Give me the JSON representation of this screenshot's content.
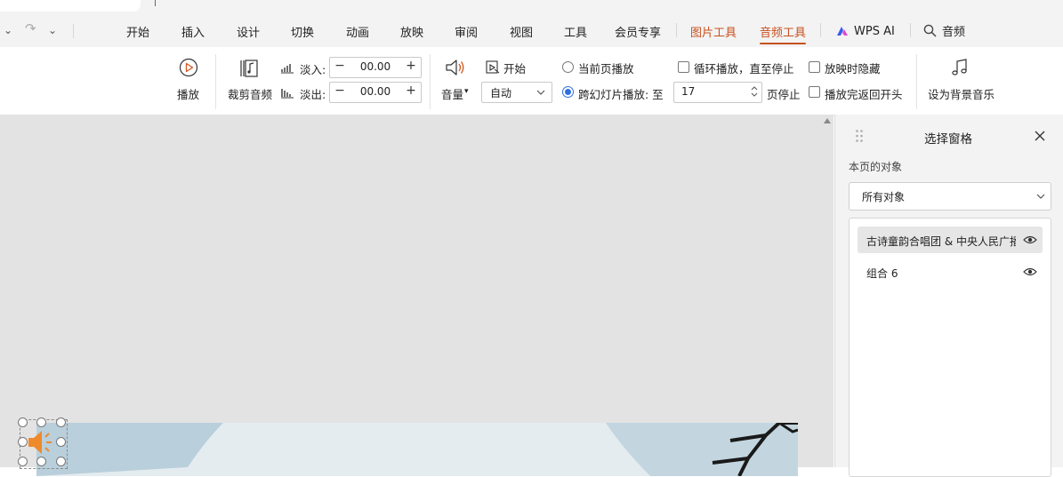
{
  "toolbar_top": {
    "redo_glyph": "↷",
    "more_glyph": "⌄"
  },
  "menu": {
    "tabs": [
      {
        "label": "开始"
      },
      {
        "label": "插入"
      },
      {
        "label": "设计"
      },
      {
        "label": "切换"
      },
      {
        "label": "动画"
      },
      {
        "label": "放映"
      },
      {
        "label": "审阅"
      },
      {
        "label": "视图"
      },
      {
        "label": "工具"
      },
      {
        "label": "会员专享"
      }
    ],
    "context_tabs": [
      {
        "label": "图片工具"
      },
      {
        "label": "音频工具"
      }
    ],
    "wps_ai_label": "WPS AI",
    "search_text": "音频",
    "accent_color": "#c8501e"
  },
  "ribbon": {
    "play_label": "播放",
    "trim_label": "裁剪音频",
    "fade_in_label": "淡入:",
    "fade_in_value": "00.00",
    "fade_out_label": "淡出:",
    "fade_out_value": "00.00",
    "minus_glyph": "−",
    "plus_glyph": "+",
    "volume_label": "音量",
    "start_label": "开始",
    "start_select_value": "自动",
    "option_current_slide": "当前页播放",
    "option_cross_slide": "跨幻灯片播放: 至",
    "stop_page_value": "17",
    "stop_page_suffix": "页停止",
    "loop_label": "循环播放，直至停止",
    "hide_label": "放映时隐藏",
    "rewind_label": "播放完返回开头",
    "bg_music_label": "设为背景音乐",
    "radio_color": "#2f6fe0"
  },
  "pane": {
    "title": "选择窗格",
    "section_label": "本页的对象",
    "filter_value": "所有对象",
    "objects": [
      {
        "label": "古诗童韵合唱团 & 中央人民广播",
        "selected": true
      },
      {
        "label": "组合 6",
        "selected": false
      }
    ]
  }
}
